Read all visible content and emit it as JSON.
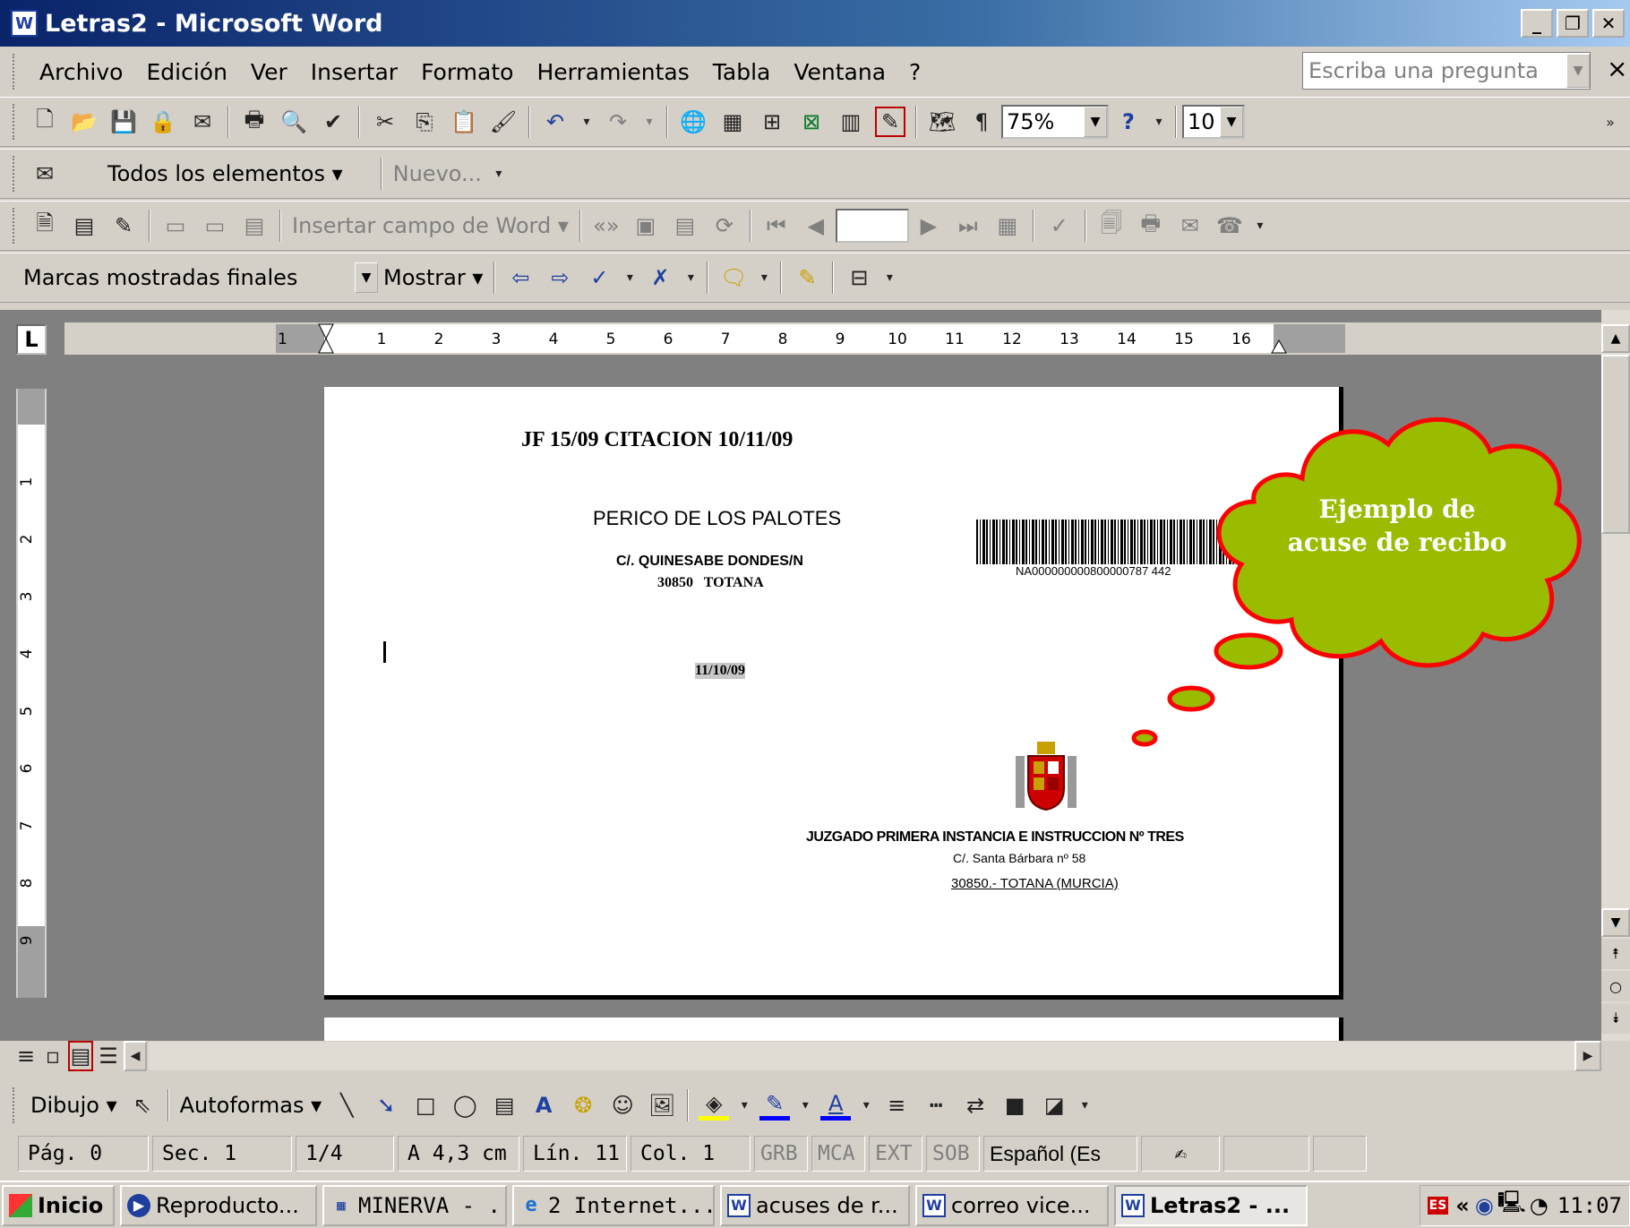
{
  "window": {
    "title": "Letras2 - Microsoft Word",
    "icon": "word-doc-icon",
    "controls": [
      "_",
      "🗗",
      "✕"
    ]
  },
  "menubar": {
    "items": [
      "Archivo",
      "Edición",
      "Ver",
      "Insertar",
      "Formato",
      "Herramientas",
      "Tabla",
      "Ventana",
      "?"
    ],
    "ask_placeholder": "Escriba una pregunta",
    "close_label": "×"
  },
  "standard_toolbar": {
    "zoom": "75%",
    "font_size": "10"
  },
  "mail_toolbar": {
    "dropdown": "Todos los elementos ▾",
    "new_label": "Nuevo..."
  },
  "merge_toolbar": {
    "insert_field": "Insertar campo de Word ▾"
  },
  "review_toolbar": {
    "display_mode": "Marcas mostradas finales",
    "show_label": "Mostrar ▾"
  },
  "ruler": {
    "horizontal_labels": [
      "1",
      "1",
      "2",
      "3",
      "4",
      "5",
      "6",
      "7",
      "8",
      "9",
      "10",
      "11",
      "12",
      "13",
      "14",
      "15",
      "16"
    ],
    "vertical_labels": [
      "1",
      "2",
      "3",
      "4",
      "5",
      "6",
      "7",
      "8",
      "9"
    ],
    "tab_selector": "L"
  },
  "document": {
    "heading": "JF 15/09 CITACION 10/11/09",
    "recipient_name": "PERICO DE LOS PALOTES",
    "recipient_address": "C/. QUINESABE DONDES/N",
    "recipient_city": "30850   TOTANA",
    "barcode_number": "NA000000000800000787 442",
    "date": "11/10/09",
    "court_name": "JUZGADO PRIMERA INSTANCIA E INSTRUCCION Nº TRES",
    "court_street": "C/. Santa Bárbara nº 58",
    "court_city": "30850.- TOTANA (MURCIA)",
    "callout": "Ejemplo de acuse de recibo"
  },
  "colors": {
    "cloud_fill": "#99bb00",
    "cloud_stroke": "#ff0000",
    "title_gradient_start": "#0a246a",
    "title_gradient_end": "#a6caf0"
  },
  "drawing_toolbar": {
    "draw_label": "Dibujo ▾",
    "autoshapes_label": "Autoformas ▾"
  },
  "status": {
    "page": "Pág. 0",
    "section": "Sec. 1",
    "pages": "1/4",
    "at": "A 4,3 cm",
    "line": "Lín. 11",
    "col": "Col. 1",
    "rec": "GRB",
    "trk": "MCA",
    "ext": "EXT",
    "ovr": "SOB",
    "language": "Español (Es"
  },
  "taskbar": {
    "start": "Inicio",
    "tasks": [
      {
        "label": "Reproducto...",
        "icon": "media-player-icon"
      },
      {
        "label": "MINERVA - ...",
        "icon": "app-icon"
      },
      {
        "label": "2 Internet...",
        "icon": "ie-icon"
      },
      {
        "label": "acuses de r...",
        "icon": "word-icon"
      },
      {
        "label": "correo vice...",
        "icon": "word-icon"
      },
      {
        "label": "Letras2 - ...",
        "icon": "word-icon"
      }
    ],
    "lang_indicator": "ES",
    "expand": "«",
    "clock": "11:07"
  }
}
